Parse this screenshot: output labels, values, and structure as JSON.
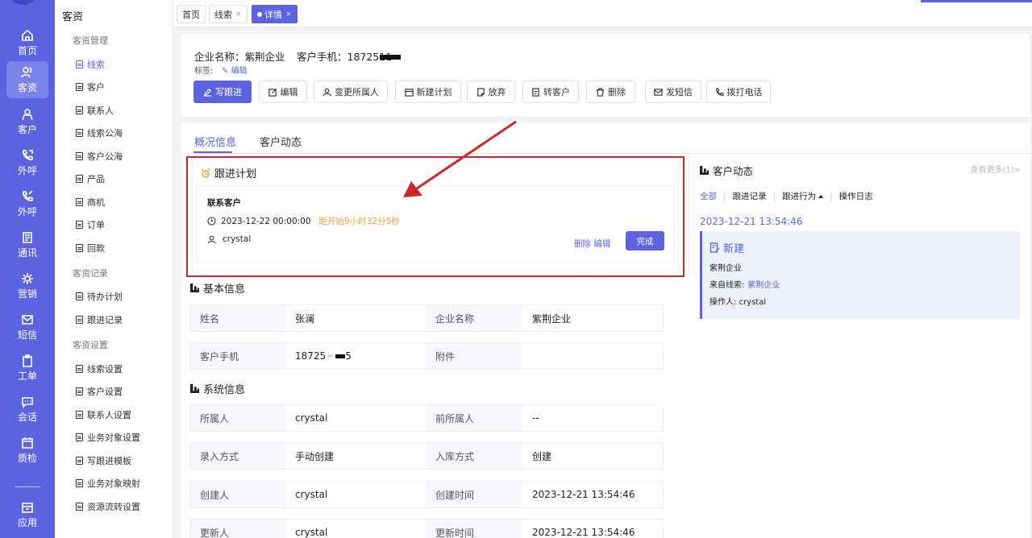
{
  "rail": {
    "items": [
      {
        "label": "首页",
        "icon": "home-icon"
      },
      {
        "label": "客资",
        "icon": "users-icon",
        "active": true
      },
      {
        "label": "客户",
        "icon": "customer-icon"
      },
      {
        "label": "外呼",
        "icon": "phone-out-icon"
      },
      {
        "label": "外呼",
        "icon": "phone-call-icon"
      },
      {
        "label": "通讯",
        "icon": "contacts-icon"
      },
      {
        "label": "营销",
        "icon": "marketing-icon"
      },
      {
        "label": "短信",
        "icon": "mail-icon"
      },
      {
        "label": "工单",
        "icon": "clipboard-icon"
      },
      {
        "label": "会话",
        "icon": "chat-icon"
      },
      {
        "label": "质检",
        "icon": "calendar-icon"
      },
      {
        "label": "应用",
        "icon": "app-icon"
      }
    ]
  },
  "menu": {
    "title": "客资",
    "groups": [
      {
        "label": "客资管理",
        "items": [
          "线索",
          "客户",
          "联系人",
          "线索公海",
          "客户公海",
          "产品",
          "商机",
          "订单",
          "回款"
        ]
      },
      {
        "label": "客资记录",
        "items": [
          "待办计划",
          "跟进记录"
        ]
      },
      {
        "label": "客资设置",
        "items": [
          "线索设置",
          "客户设置",
          "联系人设置",
          "业务对象设置",
          "写跟进模板",
          "业务对象映射",
          "资源流转设置"
        ]
      }
    ],
    "active_item": "线索"
  },
  "page_tabs": [
    {
      "label": "首页"
    },
    {
      "label": "线索",
      "close": "×"
    },
    {
      "label": "详情",
      "close": "×",
      "active": true
    }
  ],
  "header": {
    "company_label": "企业名称：紫荆企业",
    "phone_label": "客户手机：1872511",
    "tag_label": "标签:",
    "tag_edit": "编辑"
  },
  "actions": [
    "写跟进",
    "编辑",
    "变更所属人",
    "新建计划",
    "放弃",
    "转客户",
    "删除",
    "发短信",
    "拨打电话"
  ],
  "main_tabs": [
    "概况信息",
    "客户动态"
  ],
  "plan": {
    "title": "跟进计划",
    "item_title": "联系客户",
    "time": "2023-12-22 00:00:00",
    "countdown": "距开始9小时32分5秒",
    "user": "crystal",
    "delete": "删除",
    "edit": "编辑",
    "done": "完成"
  },
  "basic": {
    "title": "基本信息",
    "rows": [
      {
        "l1": "姓名",
        "v1": "张澜",
        "l2": "企业名称",
        "v2": "紫荆企业"
      },
      {
        "l1": "客户手机",
        "v1a": "18725",
        "v1b": "5",
        "l2": "附件",
        "v2": ""
      }
    ]
  },
  "system": {
    "title": "系统信息",
    "rows": [
      {
        "l1": "所属人",
        "v1": "crystal",
        "l2": "前所属人",
        "v2": "--"
      },
      {
        "l1": "录入方式",
        "v1": "手动创建",
        "l2": "入库方式",
        "v2": "创建"
      },
      {
        "l1": "创建人",
        "v1": "crystal",
        "l2": "创建时间",
        "v2": "2023-12-21 13:54:46"
      },
      {
        "l1": "更新人",
        "v1": "crystal",
        "l2": "更新时间",
        "v2": "2023-12-21 13:54:46"
      }
    ]
  },
  "activity": {
    "title": "客户动态",
    "more": "查看更多(1)>",
    "filters": [
      "全部",
      "跟进记录",
      "跟进行为",
      "操作日志"
    ],
    "date": "2023-12-21 13:54:46",
    "card": {
      "title": "新建",
      "company": "紫荆企业",
      "source_label": "来自线索:",
      "source_value": "紫荆企业",
      "operator": "操作人: crystal"
    }
  },
  "colors": {
    "accent": "#5b63e0",
    "highlight": "#c82a2a",
    "warning": "#e6a23c"
  }
}
